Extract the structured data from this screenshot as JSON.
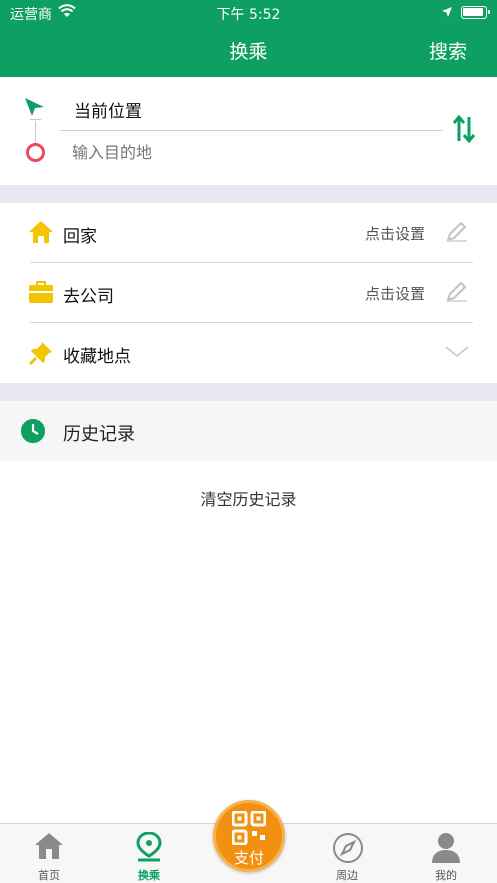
{
  "status_bar": {
    "carrier": "运营商",
    "time": "下午 5:52"
  },
  "nav": {
    "title": "换乘",
    "search_label": "搜索"
  },
  "route": {
    "from": "当前位置",
    "to_placeholder": "输入目的地"
  },
  "places": {
    "home": {
      "label": "回家",
      "action": "点击设置"
    },
    "company": {
      "label": "去公司",
      "action": "点击设置"
    },
    "favorites": {
      "label": "收藏地点"
    }
  },
  "history": {
    "title": "历史记录",
    "clear_label": "清空历史记录"
  },
  "tabs": [
    {
      "label": "首页"
    },
    {
      "label": "换乘"
    },
    {
      "label": "周边"
    },
    {
      "label": "我的"
    }
  ],
  "pay": {
    "label": "支付"
  },
  "colors": {
    "primary": "#0e9f63",
    "accent": "#f29111",
    "home_icon": "#f5c400",
    "end_marker": "#e84a5f"
  },
  "icons": [
    "wifi-icon",
    "location-arrow-icon",
    "battery-icon",
    "start-arrow-icon",
    "end-marker-icon",
    "swap-icon",
    "home-icon",
    "briefcase-icon",
    "pin-icon",
    "edit-pencil-icon",
    "chevron-down-icon",
    "clock-icon",
    "qr-code-icon"
  ]
}
